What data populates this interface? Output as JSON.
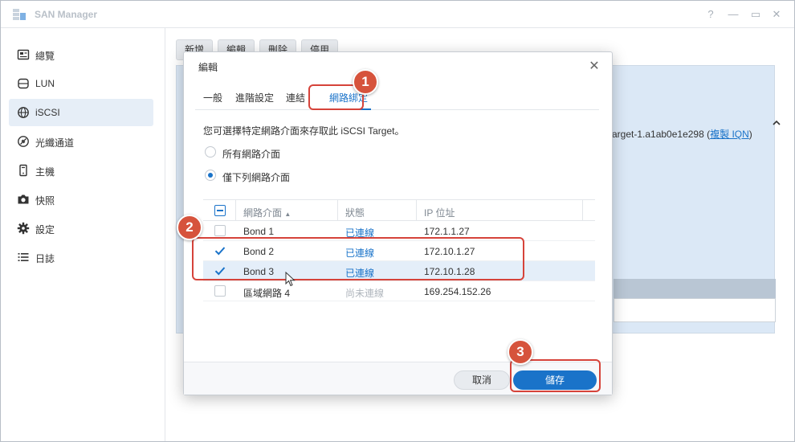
{
  "app": {
    "title": "SAN Manager",
    "window_controls": {
      "help": "?",
      "minimize": "—",
      "maximize": "▭",
      "close": "✕"
    }
  },
  "sidebar": {
    "items": [
      {
        "label": "總覽",
        "icon": "overview-icon",
        "active": false
      },
      {
        "label": "LUN",
        "icon": "lun-icon",
        "active": false
      },
      {
        "label": "iSCSI",
        "icon": "globe-icon",
        "active": true
      },
      {
        "label": "光纖通道",
        "icon": "fibre-channel-icon",
        "active": false
      },
      {
        "label": "主機",
        "icon": "host-icon",
        "active": false
      },
      {
        "label": "快照",
        "icon": "camera-icon",
        "active": false
      },
      {
        "label": "設定",
        "icon": "gear-icon",
        "active": false
      },
      {
        "label": "日誌",
        "icon": "list-icon",
        "active": false
      }
    ]
  },
  "toolbar": {
    "create": "新增",
    "edit": "編輯",
    "delete": "刪除",
    "disable": "停用"
  },
  "background_panel": {
    "iqn_text": "arget-1.a1ab0e1e298",
    "copy_iqn_link": "複製 IQN"
  },
  "dialog": {
    "title": "編輯",
    "close": "✕",
    "tabs": [
      {
        "label": "一般",
        "active": false
      },
      {
        "label": "進階設定",
        "active": false
      },
      {
        "label": "連結",
        "active": false
      },
      {
        "label": "網路綁定",
        "active": true
      }
    ],
    "description": "您可選擇特定網路介面來存取此 iSCSI Target。",
    "options": {
      "all": "所有網路介面",
      "only": "僅下列網路介面",
      "selected": "only"
    },
    "table": {
      "headers": {
        "interface": "網路介面",
        "status": "狀態",
        "ip": "IP 位址"
      },
      "sort_indicator": "▲",
      "rows": [
        {
          "interface": "Bond 1",
          "status": "已連線",
          "ip": "172.1.1.27",
          "checked": false,
          "selected": false,
          "connected": true
        },
        {
          "interface": "Bond 2",
          "status": "已連線",
          "ip": "172.10.1.27",
          "checked": true,
          "selected": false,
          "connected": true
        },
        {
          "interface": "Bond 3",
          "status": "已連線",
          "ip": "172.10.1.28",
          "checked": true,
          "selected": true,
          "connected": true
        },
        {
          "interface": "區域網路 4",
          "status": "尚未連線",
          "ip": "169.254.152.26",
          "checked": false,
          "selected": false,
          "connected": false
        }
      ]
    },
    "buttons": {
      "cancel": "取消",
      "save": "儲存"
    }
  },
  "annotations": {
    "step1": "1",
    "step2": "2",
    "step3": "3"
  },
  "colors": {
    "accent": "#1a73c9",
    "annotation": "#d6433a",
    "selected_row": "#e4eef9",
    "panel_bg": "#dbe8f6"
  }
}
